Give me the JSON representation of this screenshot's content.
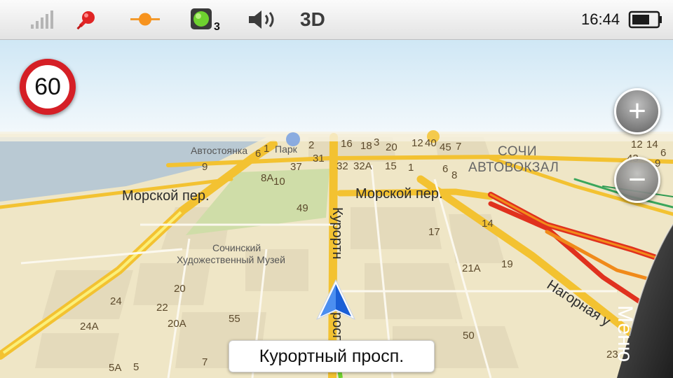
{
  "status_bar": {
    "icons": [
      "gps-signal-icon",
      "satellite-icon",
      "traffic-point-icon",
      "traffic-light-icon",
      "sound-icon"
    ],
    "traffic_count": "3",
    "view_mode": "3D",
    "time": "16:44",
    "battery_icon": "battery-icon"
  },
  "speed_limit": "60",
  "zoom": {
    "in_label": "+",
    "out_label": "−"
  },
  "map": {
    "streets": {
      "morskoy_left": "Морской пер.",
      "morskoy_right": "Морской пер.",
      "kurortny_vertical": "Курортн",
      "kurortny_vertical_lower": "росп",
      "nagornaya": "Нагорная у"
    },
    "pois": {
      "parking": "Автостоянка",
      "park": "Парк",
      "museum_line1": "Сочинский",
      "museum_line2": "Художественный Музей",
      "station_line1": "СОЧИ",
      "station_line2": "АВТОВОКЗАЛ"
    },
    "house_numbers": [
      "6",
      "1",
      "2",
      "16",
      "18",
      "3",
      "20",
      "12",
      "40",
      "45",
      "7",
      "12",
      "14",
      "6",
      "43",
      "9",
      "9",
      "37",
      "31",
      "32",
      "32А",
      "15",
      "1",
      "6",
      "8",
      "8А",
      "10",
      "49",
      "17",
      "14",
      "21А",
      "19",
      "20",
      "24",
      "22",
      "24А",
      "20А",
      "55",
      "50",
      "23",
      "5А",
      "5",
      "7"
    ]
  },
  "current_street": "Курортный просп.",
  "menu_label": "Меню",
  "colors": {
    "speed_border": "#d51f26",
    "route_traffic_red": "#e0311e",
    "route_traffic_orange": "#f08a1a",
    "road_yellow": "#f5c531",
    "nav_arrow": "#1a5fd6"
  }
}
